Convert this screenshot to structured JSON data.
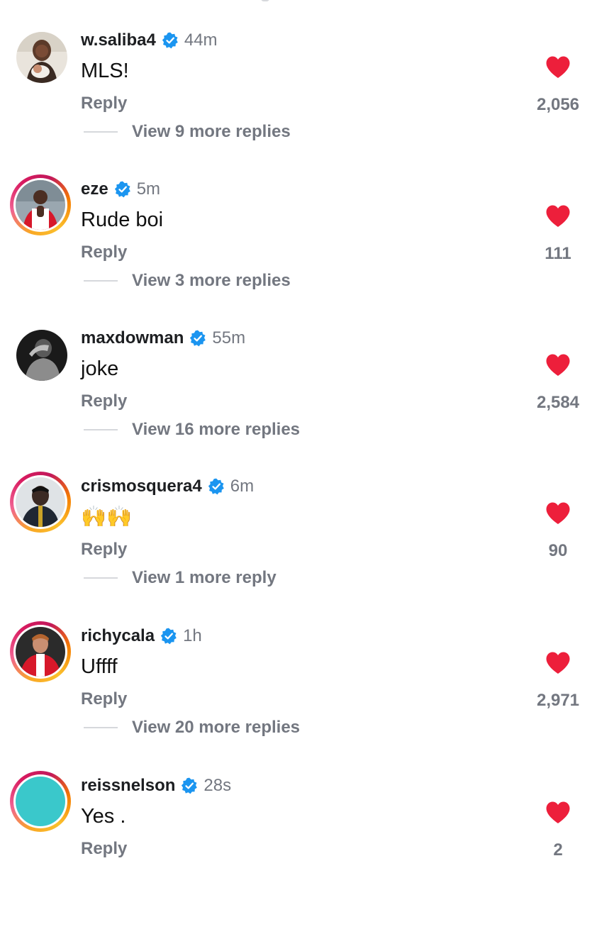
{
  "colors": {
    "heart": "#ed1f3b",
    "verified": "#1b95f0",
    "secondary_text": "#737780",
    "story_ring": [
      "#f9a825",
      "#d81b60"
    ]
  },
  "comments": [
    {
      "username": "w.saliba4",
      "verified": true,
      "time": "44m",
      "text": "MLS!",
      "reply_label": "Reply",
      "likes": "2,056",
      "liked": true,
      "view_more": "View 9 more replies",
      "story_ring": false,
      "avatar_icon": "avatar-woman-holding-baby"
    },
    {
      "username": "eze",
      "verified": true,
      "time": "5m",
      "text": "Rude boi",
      "reply_label": "Reply",
      "likes": "111",
      "liked": true,
      "view_more": "View 3 more replies",
      "story_ring": true,
      "avatar_icon": "avatar-player-red-kit-clapping"
    },
    {
      "username": "maxdowman",
      "verified": true,
      "time": "55m",
      "text": "joke",
      "reply_label": "Reply",
      "likes": "2,584",
      "liked": true,
      "view_more": "View 16 more replies",
      "story_ring": false,
      "avatar_icon": "avatar-black-and-white-portrait"
    },
    {
      "username": "crismosquera4",
      "verified": true,
      "time": "6m",
      "text": "🙌🙌",
      "reply_label": "Reply",
      "likes": "90",
      "liked": true,
      "view_more": "View 1 more reply",
      "story_ring": true,
      "avatar_icon": "avatar-player-dark-jacket"
    },
    {
      "username": "richycala",
      "verified": true,
      "time": "1h",
      "text": "Uffff",
      "reply_label": "Reply",
      "likes": "2,971",
      "liked": true,
      "view_more": "View 20 more replies",
      "story_ring": true,
      "avatar_icon": "avatar-player-red-kit-hands-on-hips"
    },
    {
      "username": "reissnelson",
      "verified": true,
      "time": "28s",
      "text": "Yes .",
      "reply_label": "Reply",
      "likes": "2",
      "liked": true,
      "view_more": "",
      "story_ring": true,
      "avatar_icon": "avatar-turquoise-circle"
    }
  ]
}
